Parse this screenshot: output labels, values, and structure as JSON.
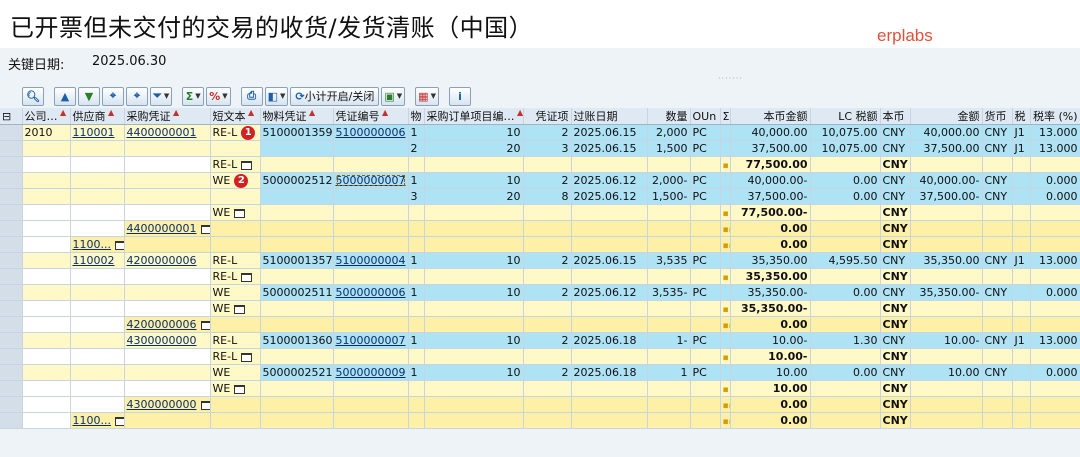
{
  "title": "已开票但未交付的交易的收货/发货清账（中国）",
  "watermark": "erplabs",
  "key_date": {
    "label": "关键日期:",
    "value": "2025.06.30"
  },
  "toolbar": {
    "subtotal_toggle_label": "小计开启/关闭"
  },
  "columns": [
    {
      "label": "公司…",
      "sorted": true
    },
    {
      "label": "供应商",
      "sorted": true
    },
    {
      "label": "采购凭证",
      "sorted": true
    },
    {
      "label": "短文本",
      "sorted": true
    },
    {
      "label": "物料凭证",
      "sorted": true
    },
    {
      "label": "凭证编号",
      "sorted": true
    },
    {
      "label": "物",
      "sorted": false
    },
    {
      "label": "采购订单项目编…",
      "sorted": true
    },
    {
      "label": "凭证项",
      "sorted": false
    },
    {
      "label": "过账日期",
      "sorted": false
    },
    {
      "label": "数量",
      "sorted": false
    },
    {
      "label": "OUn",
      "sorted": false
    },
    {
      "label": "Σ",
      "sorted": false
    },
    {
      "label": "本币金额",
      "sorted": false
    },
    {
      "label": "LC 税额",
      "sorted": false
    },
    {
      "label": "本币",
      "sorted": false
    },
    {
      "label": "金额",
      "sorted": false
    },
    {
      "label": "货币",
      "sorted": false
    },
    {
      "label": "税",
      "sorted": false
    },
    {
      "label": "税率 (%)",
      "sorted": false
    }
  ],
  "rows": [
    {
      "company": "2010",
      "vendor": "110001",
      "po": "4400000001",
      "short": "RE-L",
      "matdoc": "5100001359",
      "docno": "5100000006",
      "item": "1",
      "poitem": "10",
      "docitem": "2",
      "date": "2025.06.15",
      "qty": "2,000",
      "oun": "PC",
      "lc": "40,000.00",
      "lctax": "10,075.00",
      "lccur": "CNY",
      "amt": "40,000.00",
      "cur": "CNY",
      "tax": "J1",
      "rate": "13.000",
      "badge": "1"
    },
    {
      "item": "2",
      "poitem": "20",
      "docitem": "3",
      "date": "2025.06.15",
      "qty": "1,500",
      "oun": "PC",
      "lc": "37,500.00",
      "lctax": "10,075.00",
      "lccur": "CNY",
      "amt": "37,500.00",
      "cur": "CNY",
      "tax": "J1",
      "rate": "13.000"
    },
    {
      "subtotal": true,
      "short": "RE-L",
      "level": "1",
      "lc": "77,500.00",
      "lccur": "CNY"
    },
    {
      "short": "WE",
      "matdoc": "5000002512",
      "docno": "5000000007",
      "item": "1",
      "poitem": "10",
      "docitem": "2",
      "date": "2025.06.12",
      "qty": "2,000-",
      "oun": "PC",
      "lc": "40,000.00-",
      "lctax": "0.00",
      "lccur": "CNY",
      "amt": "40,000.00-",
      "cur": "CNY",
      "rate": "0.000",
      "badge": "2"
    },
    {
      "item": "3",
      "poitem": "20",
      "docitem": "8",
      "date": "2025.06.12",
      "qty": "1,500-",
      "oun": "PC",
      "lc": "37,500.00-",
      "lctax": "0.00",
      "lccur": "CNY",
      "amt": "37,500.00-",
      "cur": "CNY",
      "rate": "0.000"
    },
    {
      "subtotal": true,
      "short": "WE",
      "level": "1",
      "lc": "77,500.00-",
      "lccur": "CNY"
    },
    {
      "subtotal": true,
      "po": "4400000001",
      "level": "2",
      "lc": "0.00",
      "lccur": "CNY"
    },
    {
      "subtotal": true,
      "vendor": "1100...",
      "level": "3",
      "lc": "0.00",
      "lccur": "CNY"
    },
    {
      "vendor": "110002",
      "po": "4200000006",
      "short": "RE-L",
      "matdoc": "5100001357",
      "docno": "5100000004",
      "item": "1",
      "poitem": "10",
      "docitem": "2",
      "date": "2025.06.15",
      "qty": "3,535",
      "oun": "PC",
      "lc": "35,350.00",
      "lctax": "4,595.50",
      "lccur": "CNY",
      "amt": "35,350.00",
      "cur": "CNY",
      "tax": "J1",
      "rate": "13.000"
    },
    {
      "subtotal": true,
      "short": "RE-L",
      "level": "1",
      "lc": "35,350.00",
      "lccur": "CNY"
    },
    {
      "short": "WE",
      "matdoc": "5000002511",
      "docno": "5000000006",
      "item": "1",
      "poitem": "10",
      "docitem": "2",
      "date": "2025.06.12",
      "qty": "3,535-",
      "oun": "PC",
      "lc": "35,350.00-",
      "lctax": "0.00",
      "lccur": "CNY",
      "amt": "35,350.00-",
      "cur": "CNY",
      "rate": "0.000"
    },
    {
      "subtotal": true,
      "short": "WE",
      "level": "1",
      "lc": "35,350.00-",
      "lccur": "CNY"
    },
    {
      "subtotal": true,
      "po": "4200000006",
      "level": "2",
      "lc": "0.00",
      "lccur": "CNY"
    },
    {
      "po": "4300000000",
      "short": "RE-L",
      "matdoc": "5100001360",
      "docno": "5100000007",
      "item": "1",
      "poitem": "10",
      "docitem": "2",
      "date": "2025.06.18",
      "qty": "1-",
      "oun": "PC",
      "lc": "10.00-",
      "lctax": "1.30",
      "lccur": "CNY",
      "amt": "10.00-",
      "cur": "CNY",
      "tax": "J1",
      "rate": "13.000"
    },
    {
      "subtotal": true,
      "short": "RE-L",
      "level": "1",
      "lc": "10.00-",
      "lccur": "CNY"
    },
    {
      "short": "WE",
      "matdoc": "5000002521",
      "docno": "5000000009",
      "item": "1",
      "poitem": "10",
      "docitem": "2",
      "date": "2025.06.18",
      "qty": "1",
      "oun": "PC",
      "lc": "10.00",
      "lctax": "0.00",
      "lccur": "CNY",
      "amt": "10.00",
      "cur": "CNY",
      "rate": "0.000"
    },
    {
      "subtotal": true,
      "short": "WE",
      "level": "1",
      "lc": "10.00",
      "lccur": "CNY"
    },
    {
      "subtotal": true,
      "po": "4300000000",
      "level": "2",
      "lc": "0.00",
      "lccur": "CNY"
    },
    {
      "subtotal": true,
      "vendor": "1100...",
      "level": "3",
      "lc": "0.00",
      "lccur": "CNY"
    }
  ]
}
